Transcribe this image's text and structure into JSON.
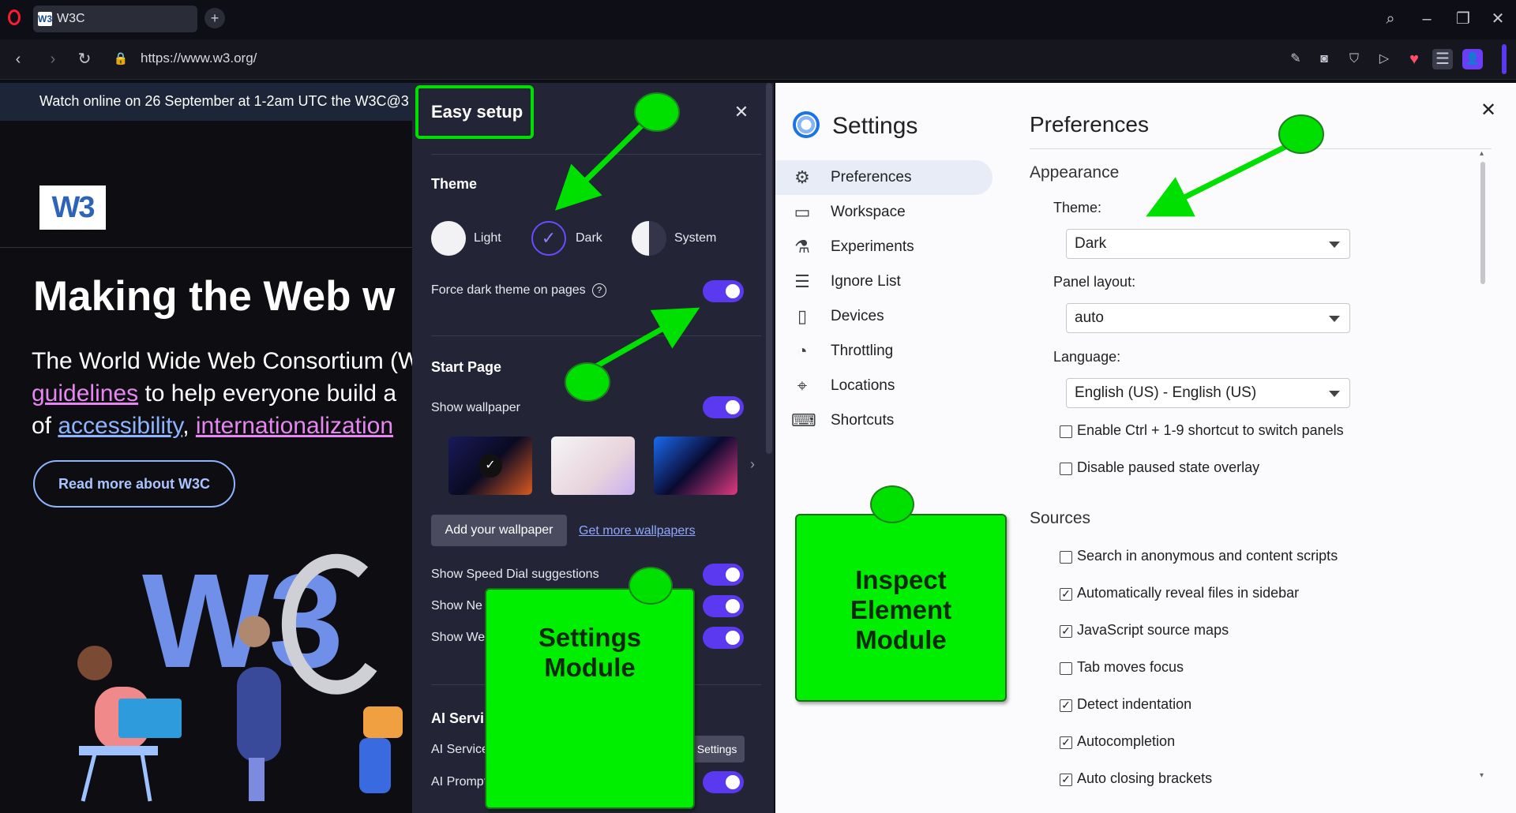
{
  "browser": {
    "tab_title": "W3C",
    "tab_favicon": "W3",
    "url": "https://www.w3.org/"
  },
  "page": {
    "banner_text": "Watch online on 26 September at 1-2am UTC the W3C@3",
    "logo_text": "W3",
    "hero_title": "Making the Web w",
    "hero_line1": "The World Wide Web Consortium (W",
    "hero_line2_link": "guidelines",
    "hero_line2_rest": " to help everyone build a",
    "hero_line3_pre": "of ",
    "hero_line3_link1": "accessibility",
    "hero_line3_sep": ", ",
    "hero_line3_link2": "internationalization",
    "read_more": "Read more about W3C"
  },
  "easy_setup": {
    "title": "Easy setup",
    "theme_heading": "Theme",
    "theme_options": [
      "Light",
      "Dark",
      "System"
    ],
    "selected_theme": "Dark",
    "force_dark": "Force dark theme on pages",
    "force_dark_on": true,
    "start_page_heading": "Start Page",
    "show_wallpaper": "Show wallpaper",
    "add_wallpaper": "Add your wallpaper",
    "get_more": "Get more wallpapers",
    "speed_dial": "Show Speed Dial suggestions",
    "show_news": "Show Ne",
    "show_weather": "Show We",
    "ai_heading": "AI Servi",
    "ai_sidebar": "AI Services in sidebar",
    "sidebar_settings": "Sidebar Settings",
    "ai_prompts": "AI Prompts in text highlight popup",
    "accent": "#5a39f0"
  },
  "devtools": {
    "title": "Settings",
    "sidebar": [
      {
        "label": "Preferences",
        "icon": "gear-icon",
        "glyph": "⚙"
      },
      {
        "label": "Workspace",
        "icon": "folder-icon",
        "glyph": "▭"
      },
      {
        "label": "Experiments",
        "icon": "flask-icon",
        "glyph": "⚗"
      },
      {
        "label": "Ignore List",
        "icon": "list-x-icon",
        "glyph": "☰"
      },
      {
        "label": "Devices",
        "icon": "devices-icon",
        "glyph": "▯"
      },
      {
        "label": "Throttling",
        "icon": "gauge-icon",
        "glyph": "◔"
      },
      {
        "label": "Locations",
        "icon": "pin-icon",
        "glyph": "⌖"
      },
      {
        "label": "Shortcuts",
        "icon": "keyboard-icon",
        "glyph": "⌨"
      }
    ],
    "heading": "Preferences",
    "appearance": "Appearance",
    "theme_label": "Theme:",
    "theme_value": "Dark",
    "panel_label": "Panel layout:",
    "panel_value": "auto",
    "language_label": "Language:",
    "language_value": "English (US) - English (US)",
    "appearance_checks": [
      {
        "label": "Enable Ctrl + 1-9 shortcut to switch panels",
        "checked": false
      },
      {
        "label": "Disable paused state overlay",
        "checked": false
      }
    ],
    "sources": "Sources",
    "source_checks": [
      {
        "label": "Search in anonymous and content scripts",
        "checked": false
      },
      {
        "label": "Automatically reveal files in sidebar",
        "checked": true
      },
      {
        "label": "JavaScript source maps",
        "checked": true
      },
      {
        "label": "Tab moves focus",
        "checked": false
      },
      {
        "label": "Detect indentation",
        "checked": true
      },
      {
        "label": "Autocompletion",
        "checked": true
      },
      {
        "label": "Auto closing brackets",
        "checked": true
      }
    ]
  },
  "annotations": {
    "settings_module": [
      "Settings",
      "Module"
    ],
    "inspect_module": [
      "Inspect",
      "Element",
      "Module"
    ],
    "highlight_color": "#00e000"
  }
}
